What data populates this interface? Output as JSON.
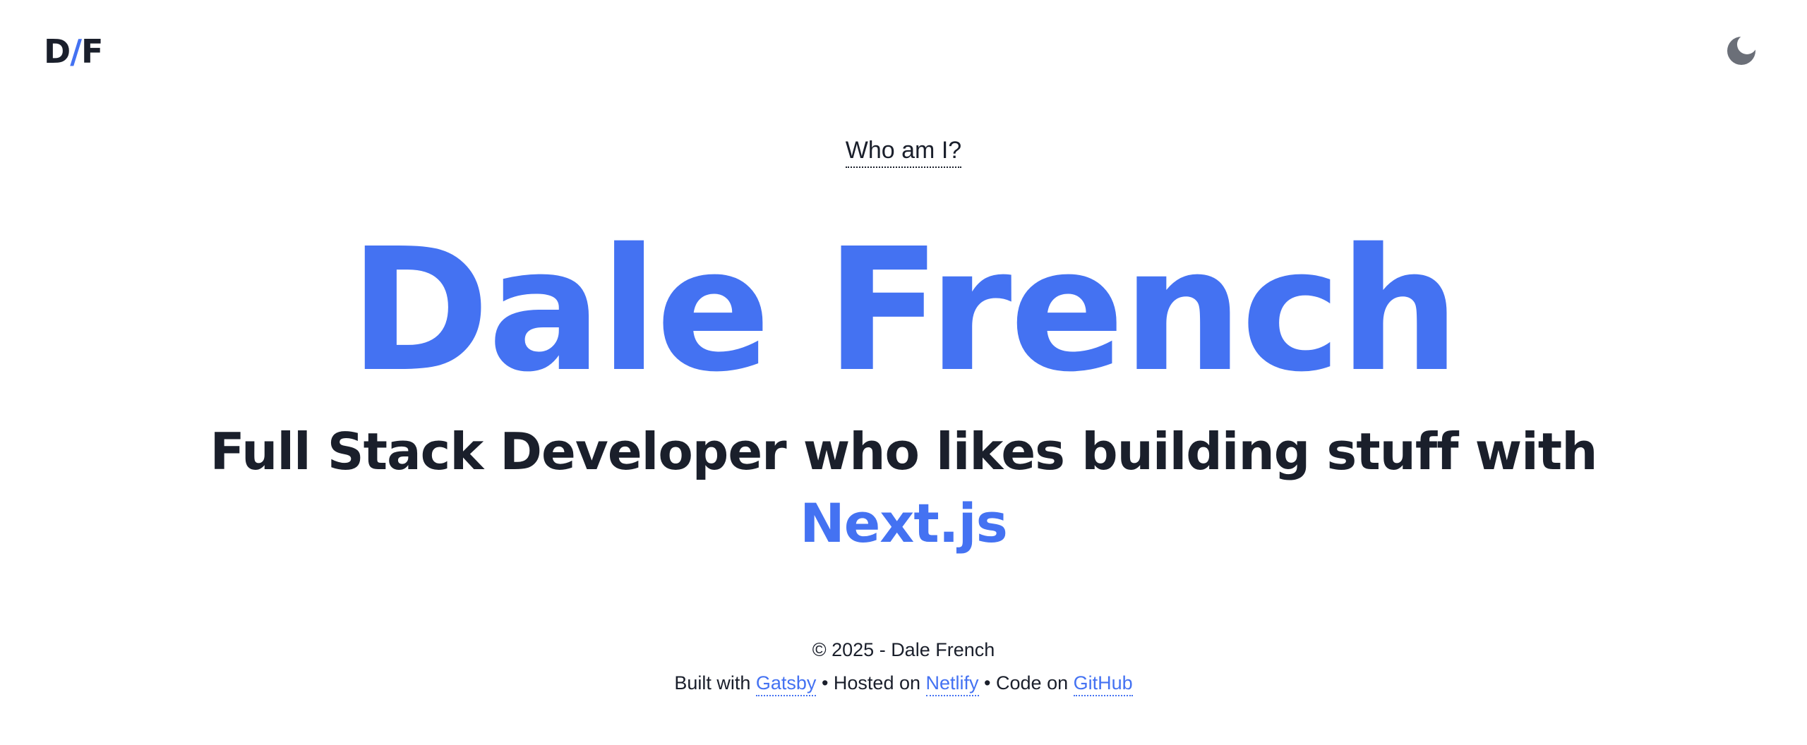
{
  "header": {
    "logo": {
      "left": "D",
      "slash": "/",
      "right": "F"
    },
    "theme_toggle_icon": "moon-icon"
  },
  "intro": {
    "who_link": "Who am I?"
  },
  "hero": {
    "name": "Dale French",
    "subtitle": "Full Stack Developer who likes building stuff with",
    "technology": "Next.js"
  },
  "footer": {
    "copyright": "© 2025 - Dale French",
    "built_with_label": "Built with",
    "built_with_link": "Gatsby",
    "separator1": "•",
    "hosted_on_label": "Hosted on",
    "hosted_on_link": "Netlify",
    "separator2": "•",
    "code_on_label": "Code on",
    "code_on_link": "GitHub"
  },
  "colors": {
    "accent": "#4472f2",
    "text": "#1a1f2b",
    "background": "#ffffff",
    "icon": "#6b6f78"
  }
}
